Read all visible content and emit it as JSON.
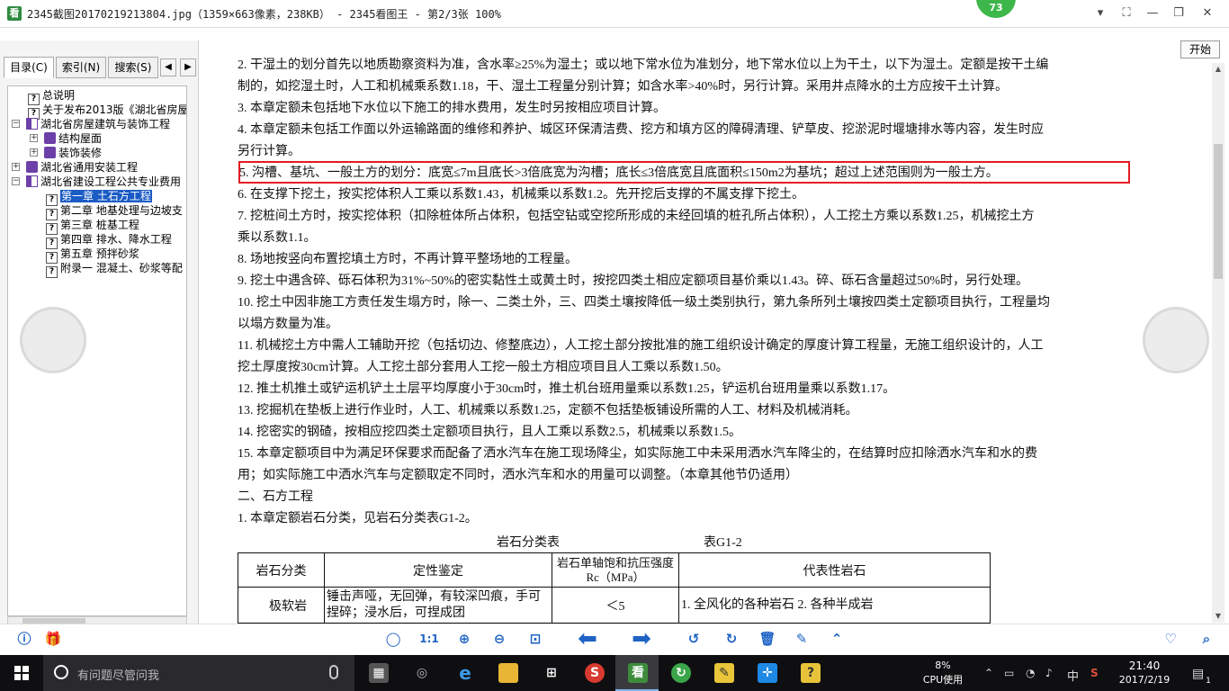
{
  "window": {
    "title": "2345截图20170219213804.jpg（1359×663像素，238KB） - 2345看图王 - 第2/3张 100%",
    "badge": "73",
    "app_icon": "看"
  },
  "sidebar": {
    "tabs": [
      "目录(C)",
      "索引(N)",
      "搜索(S)"
    ],
    "start_button": "开始",
    "tree": [
      {
        "label": "总说明",
        "icon": "help-doc-icon",
        "level": 1
      },
      {
        "label": "关于发布2013版《湖北省房屋",
        "icon": "help-doc-icon",
        "level": 1
      },
      {
        "label": "湖北省房屋建筑与装饰工程",
        "icon": "book-open-icon",
        "level": 0,
        "expander": "−"
      },
      {
        "label": "结构屋面",
        "icon": "book-icon",
        "level": 1,
        "expander": "+"
      },
      {
        "label": "装饰装修",
        "icon": "book-icon",
        "level": 1,
        "expander": "+"
      },
      {
        "label": "湖北省通用安装工程",
        "icon": "book-icon",
        "level": 0,
        "expander": "+"
      },
      {
        "label": "湖北省建设工程公共专业费用",
        "icon": "book-open-icon",
        "level": 0,
        "expander": "−"
      },
      {
        "label": "第一章  土石方工程",
        "icon": "help-doc-icon",
        "level": 2,
        "selected": true
      },
      {
        "label": "第二章  地基处理与边坡支",
        "icon": "help-doc-icon",
        "level": 2
      },
      {
        "label": "第三章  桩基工程",
        "icon": "help-doc-icon",
        "level": 2
      },
      {
        "label": "第四章  排水、降水工程",
        "icon": "help-doc-icon",
        "level": 2
      },
      {
        "label": "第五章  预拌砂浆",
        "icon": "help-doc-icon",
        "level": 2
      },
      {
        "label": "附录一  混凝土、砂浆等配",
        "icon": "help-doc-icon",
        "level": 2
      }
    ]
  },
  "document": {
    "lines": [
      "2. 干湿土的划分首先以地质勘察资料为准，含水率≥25%为湿土；或以地下常水位为准划分，地下常水位以上为干土，以下为湿土。定额是按干土编",
      "制的，如挖湿土时，人工和机械乘系数1.18，干、湿土工程量分别计算；如含水率>40%时，另行计算。采用井点降水的土方应按干土计算。",
      "3. 本章定额未包括地下水位以下施工的排水费用，发生时另按相应项目计算。",
      "4. 本章定额未包括工作面以外运输路面的维修和养护、城区环保清洁费、挖方和填方区的障碍清理、铲草皮、挖淤泥时堰塘排水等内容，发生时应",
      "另行计算。",
      "5. 沟槽、基坑、一般土方的划分：底宽≤7m且底长>3倍底宽为沟槽；底长≤3倍底宽且底面积≤150m2为基坑；超过上述范围则为一般土方。",
      "6. 在支撑下挖土，按实挖体积人工乘以系数1.43，机械乘以系数1.2。先开挖后支撑的不属支撑下挖土。",
      "7. 挖桩间土方时，按实挖体积（扣除桩体所占体积，包括空钻或空挖所形成的未经回填的桩孔所占体积），人工挖土方乘以系数1.25，机械挖土方",
      "乘以系数1.1。",
      "8. 场地按竖向布置挖填土方时，不再计算平整场地的工程量。",
      "9. 挖土中遇含碎、砾石体积为31%~50%的密实黏性土或黄土时，按挖四类土相应定额项目基价乘以1.43。碎、砾石含量超过50%时，另行处理。",
      "10. 挖土中因非施工方责任发生塌方时，除一、二类土外，三、四类土壤按降低一级土类别执行，第九条所列土壤按四类土定额项目执行，工程量均",
      "以塌方数量为准。",
      "11. 机械挖土方中需人工辅助开挖（包括切边、修整底边），人工挖土部分按批准的施工组织设计确定的厚度计算工程量，无施工组织设计的，人工",
      "挖土厚度按30cm计算。人工挖土部分套用人工挖一般土方相应项目且人工乘以系数1.50。",
      "12. 推土机推土或铲运机铲土土层平均厚度小于30cm时，推土机台班用量乘以系数1.25，铲运机台班用量乘以系数1.17。",
      "13. 挖掘机在垫板上进行作业时，人工、机械乘以系数1.25，定额不包括垫板铺设所需的人工、材料及机械消耗。",
      "14. 挖密实的钢碴，按相应挖四类土定额项目执行，且人工乘以系数2.5，机械乘以系数1.5。",
      "15. 本章定额项目中为满足环保要求而配备了洒水汽车在施工现场降尘，如实际施工中未采用洒水汽车降尘的，在结算时应扣除洒水汽车和水的费",
      "用；如实际施工中洒水汽车与定额取定不同时，洒水汽车和水的用量可以调整。（本章其他节仍适用）",
      "二、石方工程",
      "1. 本章定额岩石分类，见岩石分类表G1-2。"
    ],
    "table_title": "岩石分类表",
    "table_no": "表G1-2",
    "table": {
      "headers": [
        "岩石分类",
        "定性鉴定",
        "岩石单轴饱和抗压强度Rc（MPa）",
        "代表性岩石"
      ],
      "row1": {
        "category": "极软岩",
        "qualitative": "锤击声哑，无回弹，有较深凹痕，手可捏碎；浸水后，可捏成团",
        "strength": "＜5",
        "rocks": "1. 全风化的各种岩石  2. 各种半成岩"
      }
    }
  },
  "taskbar": {
    "search_placeholder": "有问题尽管问我",
    "cpu_percent": "8%",
    "cpu_label": "CPU使用",
    "ime": "中",
    "time": "21:40",
    "date": "2017/2/19",
    "notifications": "1"
  }
}
